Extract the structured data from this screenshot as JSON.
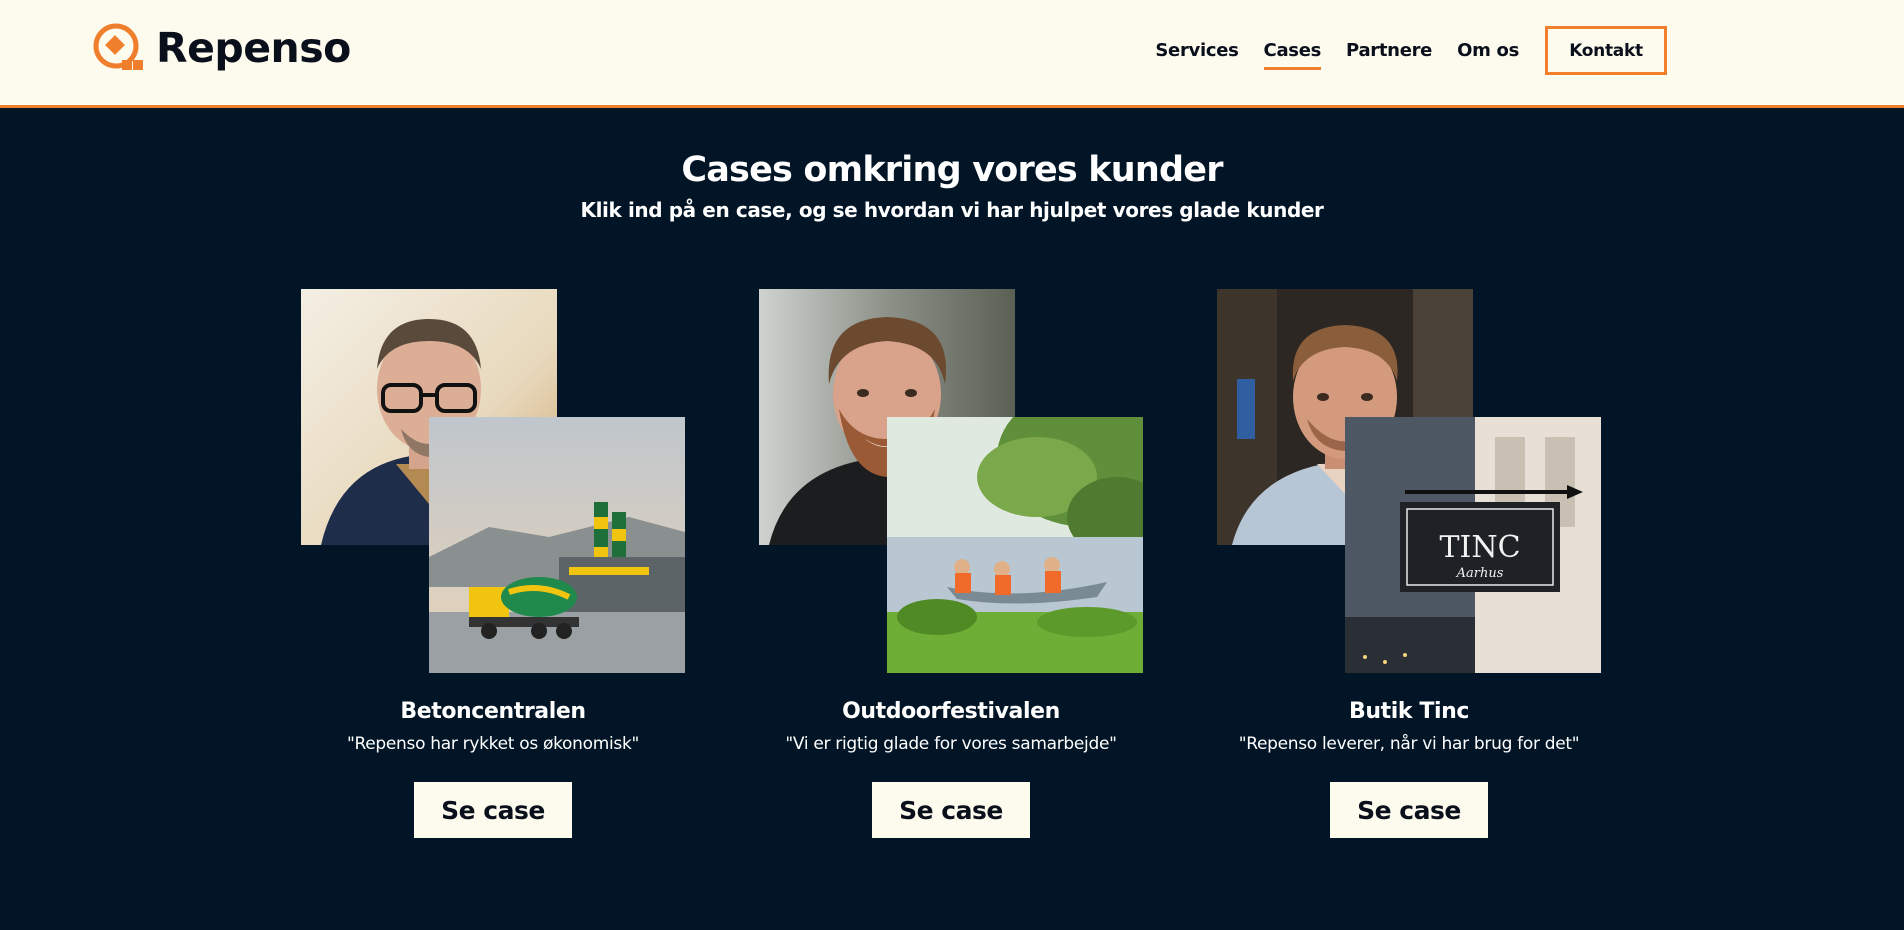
{
  "brand": {
    "name": "Repenso",
    "accent": "#f07f2d",
    "background": "#021526",
    "cream": "#fdfaee"
  },
  "nav": {
    "items": [
      {
        "label": "Services",
        "active": false
      },
      {
        "label": "Cases",
        "active": true
      },
      {
        "label": "Partnere",
        "active": false
      },
      {
        "label": "Om os",
        "active": false
      }
    ],
    "contact_label": "Kontakt"
  },
  "main": {
    "title": "Cases omkring vores kunder",
    "subtitle": "Klik ind på en case, og se hvordan vi har hjulpet vores glade kunder"
  },
  "cases": [
    {
      "name": "Betoncentralen",
      "quote": "\"Repenso har rykket os økonomisk\"",
      "button_label": "Se case",
      "portrait": "man-with-glasses-portrait",
      "scene": "concrete-plant-photo"
    },
    {
      "name": "Outdoorfestivalen",
      "quote": "\"Vi er rigtig glade for vores samarbejde\"",
      "button_label": "Se case",
      "portrait": "bearded-man-portrait",
      "scene": "canoe-lake-photo"
    },
    {
      "name": "Butik Tinc",
      "quote": "\"Repenso leverer, når vi har brug for det\"",
      "button_label": "Se case",
      "portrait": "man-in-shop-portrait",
      "scene": "shop-sign-photo",
      "sign_text": "TINC",
      "sign_sub": "Aarhus"
    }
  ]
}
